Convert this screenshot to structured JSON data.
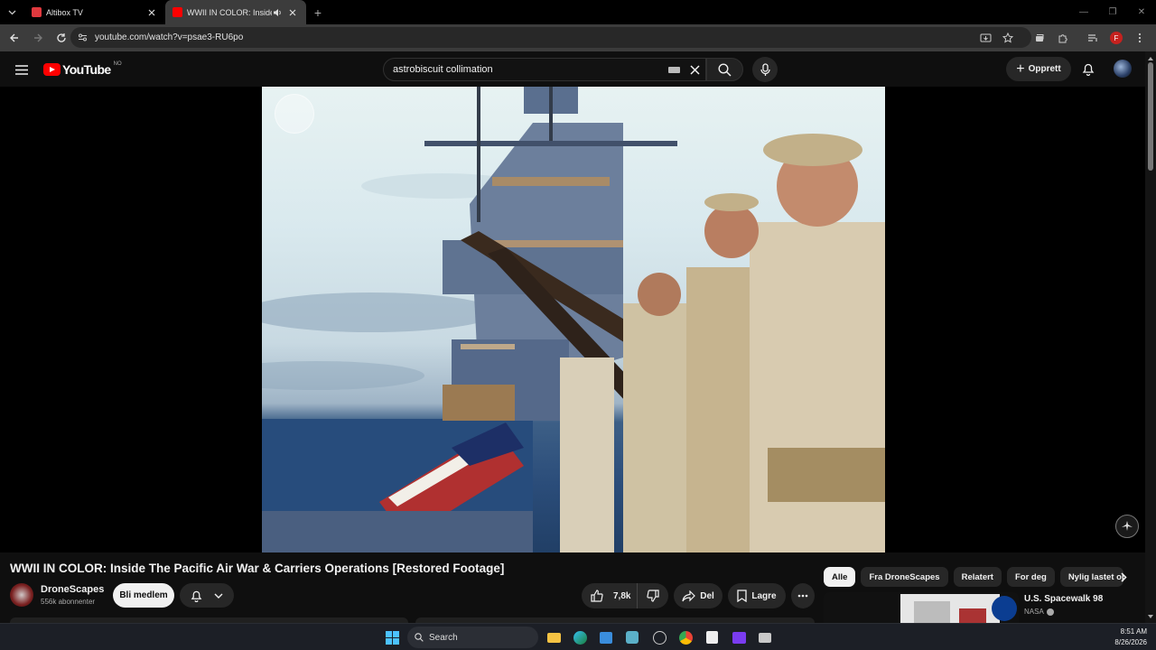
{
  "browser": {
    "tabs": [
      {
        "title": "Altibox TV",
        "active": false,
        "favicon_color": "#e0393e"
      },
      {
        "title": "WWII IN COLOR: Inside The",
        "active": true,
        "favicon_color": "#ff0000"
      }
    ],
    "url": "youtube.com/watch?v=psae3-RU6po",
    "profile_initial": "F"
  },
  "youtube": {
    "logo_text": "YouTube",
    "country_code": "NO",
    "search_query": "astrobiscuit collimation",
    "create_label": "Opprett"
  },
  "video": {
    "title": "WWII IN COLOR: Inside The Pacific Air War & Carriers Operations [Restored Footage]",
    "channel": {
      "name": "DroneScapes",
      "subscribers": "556k abonnenter"
    },
    "join_label": "Bli medlem",
    "likes": "7,8k",
    "share_label": "Del",
    "save_label": "Lagre"
  },
  "chips": [
    {
      "label": "Alle",
      "active": true
    },
    {
      "label": "Fra DroneScapes",
      "active": false
    },
    {
      "label": "Relatert",
      "active": false
    },
    {
      "label": "For deg",
      "active": false
    },
    {
      "label": "Nylig lastet opp",
      "active": false
    }
  ],
  "recommendation": {
    "title": "U.S. Spacewalk 98",
    "channel": "NASA"
  },
  "taskbar": {
    "search_label": "Search",
    "time": "8:51 AM",
    "date": "8/26/2026"
  },
  "colors": {
    "accent": "#ff0000",
    "background": "#0f0f0f",
    "chip_active": "#f1f1f1"
  }
}
